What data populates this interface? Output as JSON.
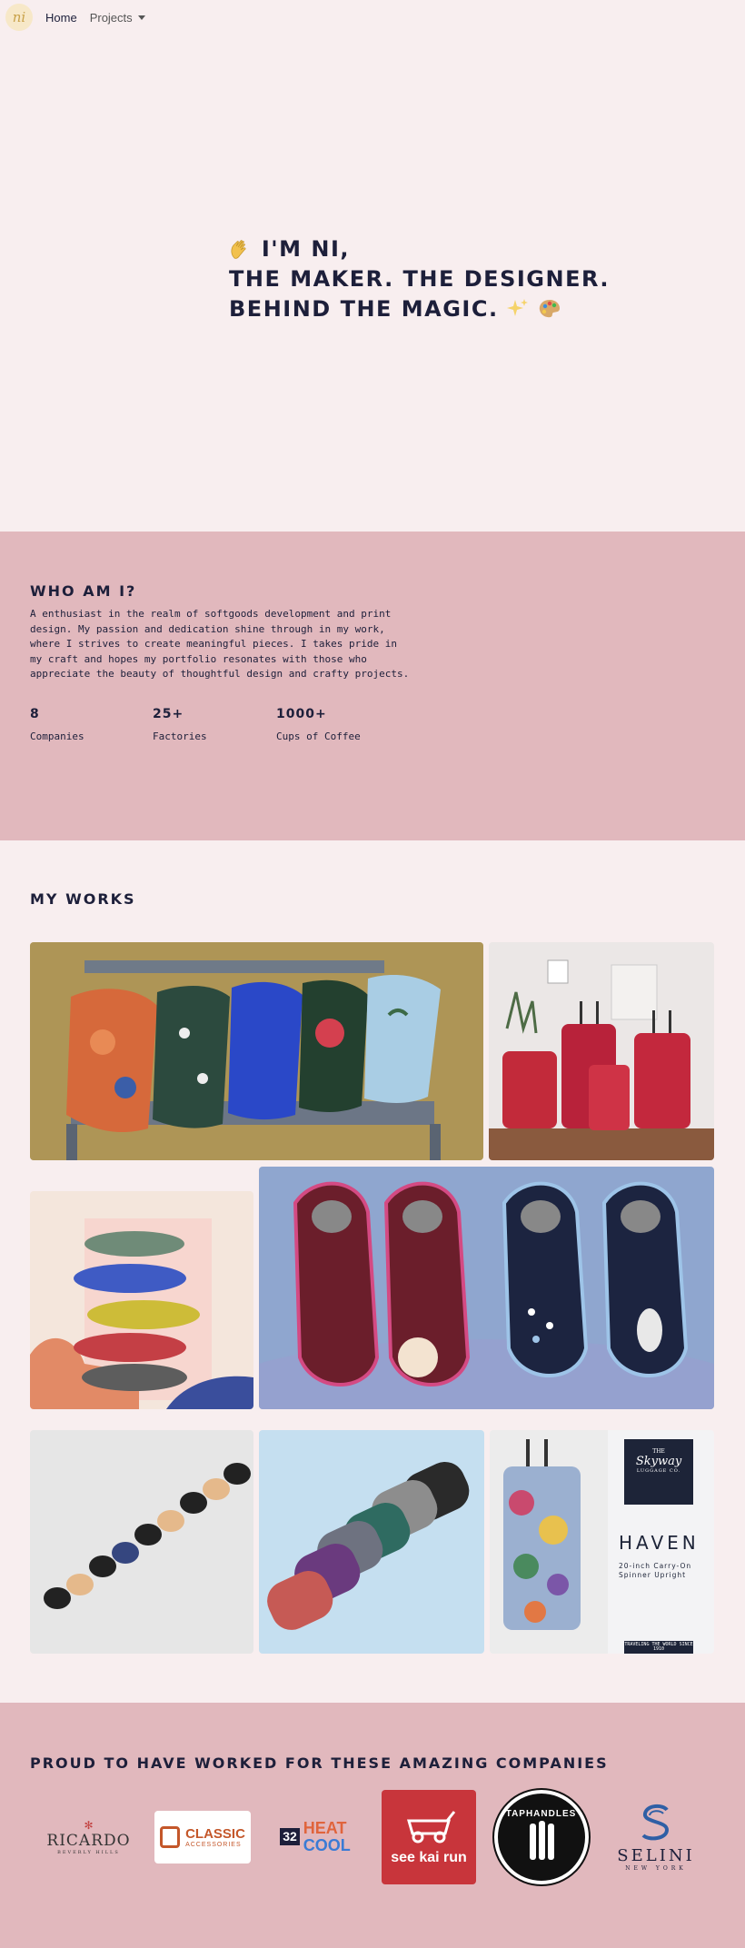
{
  "nav": {
    "logo_text": "ni",
    "home": "Home",
    "projects": "Projects"
  },
  "hero": {
    "line1": "I'M NI,",
    "line2": "THE MAKER. THE DESIGNER.",
    "line3": "BEHIND THE MAGIC.",
    "wave_icon": "waving-hand-icon",
    "sparkles_icon": "sparkles-icon",
    "palette_icon": "artist-palette-icon"
  },
  "about": {
    "title": "WHO AM I?",
    "text": "A enthusiast in the realm of softgoods development and print design. My passion and dedication shine through in my work, where I strives to create meaningful pieces. I takes pride in my craft and hopes my portfolio resonates with those who appreciate the beauty of thoughtful design and crafty projects.",
    "stats": [
      {
        "num": "8",
        "label": "Companies"
      },
      {
        "num": "25+",
        "label": "Factories"
      },
      {
        "num": "1000+",
        "label": "Cups of Coffee"
      }
    ]
  },
  "works": {
    "title": "MY WORKS",
    "items": [
      "printed pillows",
      "red luggage set",
      "stacked slides",
      "kids slippers",
      "sunglasses",
      "belt bags",
      "haven luggage"
    ],
    "haven": {
      "brand_the": "THE",
      "brand_name": "Skyway",
      "brand_sub": "LUGGAGE CO.",
      "heading": "HAVEN",
      "desc": "20-inch Carry-On Spinner Upright",
      "footer": "TRAVELING THE WORLD SINCE 1910"
    }
  },
  "companies": {
    "title": "PROUD TO HAVE WORKED FOR THESE AMAZING COMPANIES",
    "ricardo": {
      "name": "RICARDO",
      "sub": "BEVERLY HILLS"
    },
    "classic": {
      "name": "CLASSIC",
      "sub": "ACCESSORIES"
    },
    "heatcool": {
      "num": "32",
      "heat": "HEAT",
      "cool": "COOL"
    },
    "seekairun": {
      "name": "see kai run"
    },
    "taphandles": {
      "name": "TAPHANDLES"
    },
    "selini": {
      "name": "SELINI",
      "sub": "NEW YORK"
    }
  },
  "colors": {
    "page_bg": "#f8eeef",
    "accent_pink": "#e1b8bd",
    "navy": "#1d1f3a"
  }
}
